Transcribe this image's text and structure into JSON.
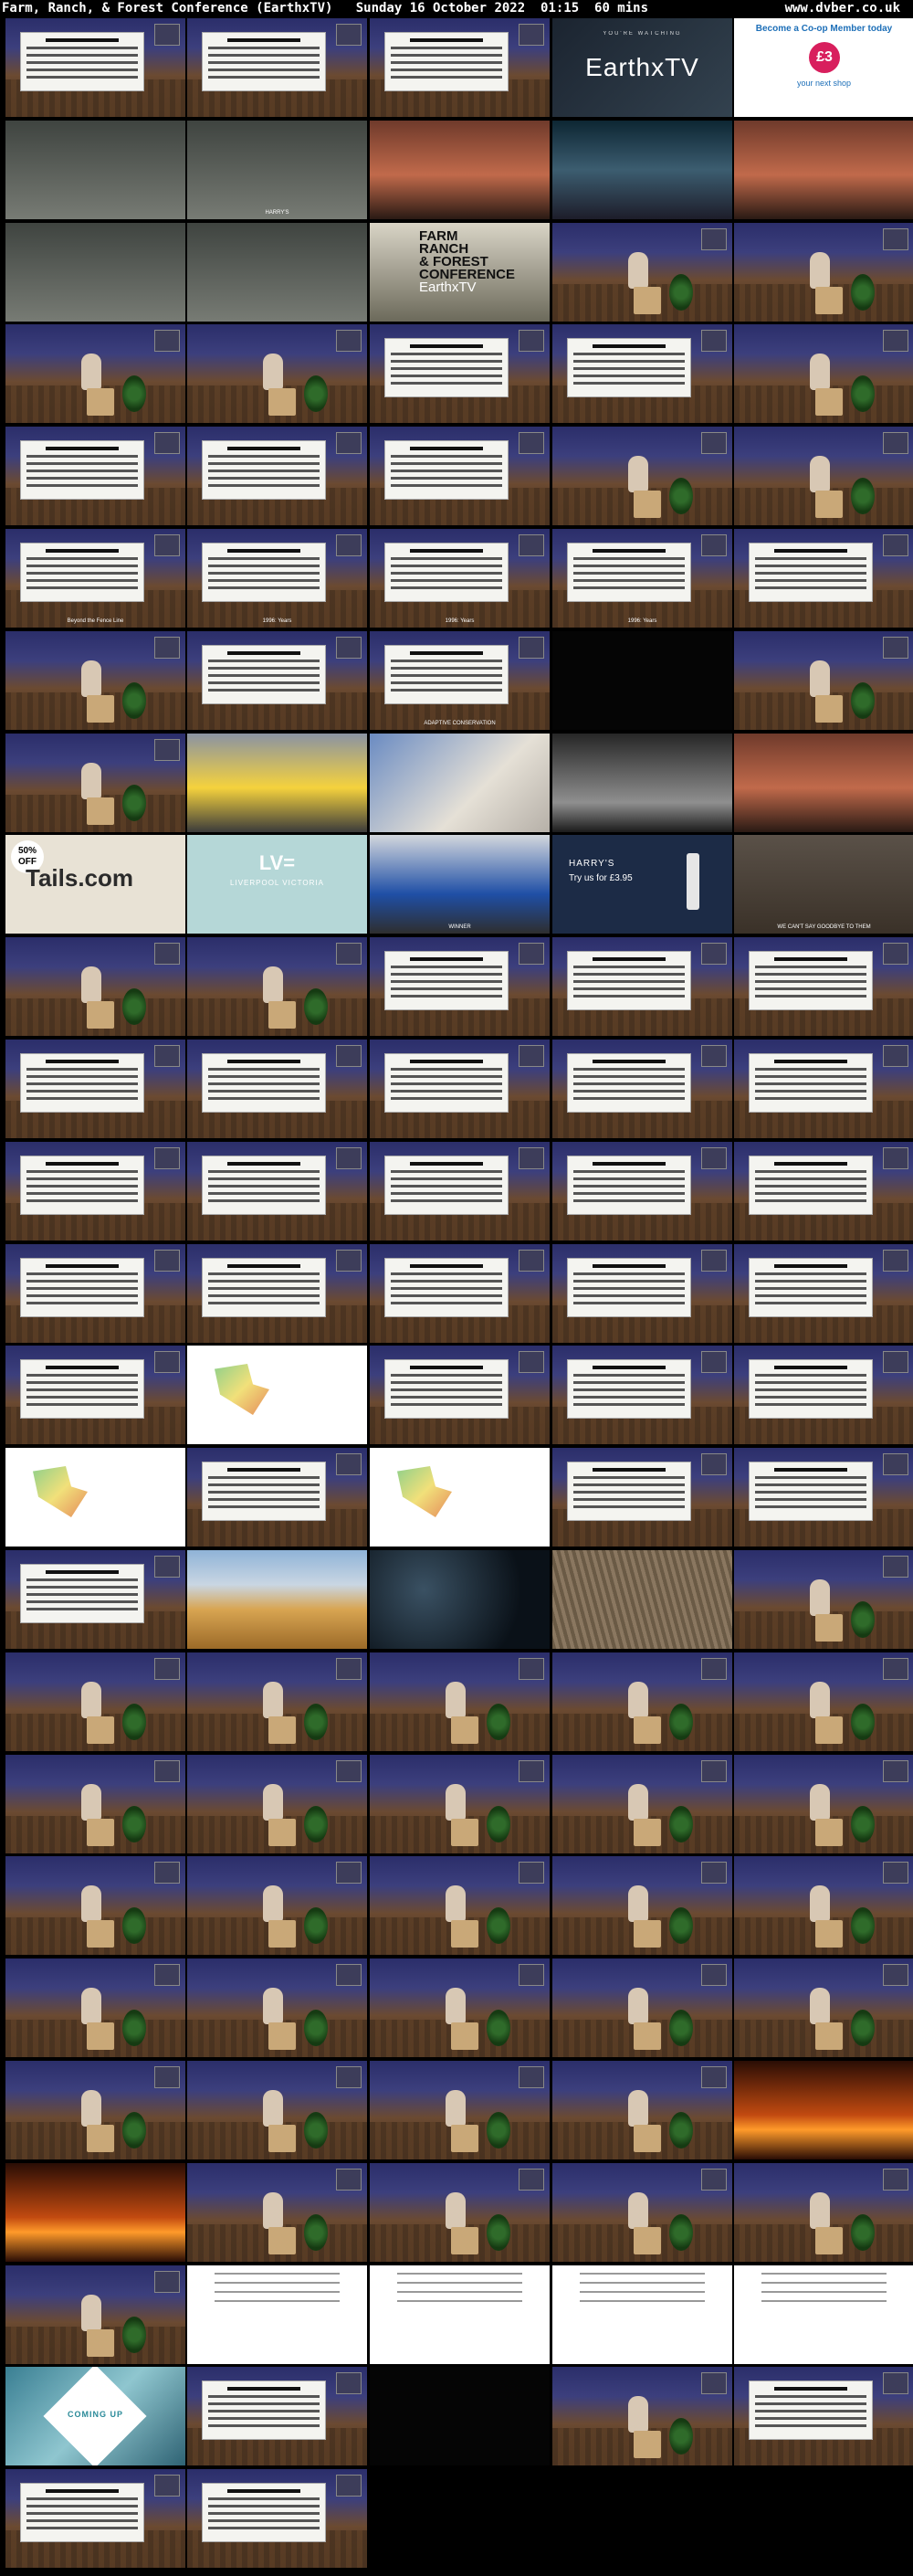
{
  "header": {
    "title": "Farm, Ranch, & Forest Conference (EarthxTV)   Sunday 16 October 2022  01:15  60 mins",
    "site": "www.dvber.co.uk"
  },
  "thumbnails": [
    {
      "kind": "slide"
    },
    {
      "kind": "slide"
    },
    {
      "kind": "slide"
    },
    {
      "kind": "earthx",
      "small": "YOU'RE WATCHING",
      "big": "EarthxTV"
    },
    {
      "kind": "coop",
      "title": "Become a Co-op Member today",
      "badge": "£3",
      "sub": "your next shop"
    },
    {
      "kind": "phone"
    },
    {
      "kind": "phone",
      "caption": "HARRY'S"
    },
    {
      "kind": "desert"
    },
    {
      "kind": "sky"
    },
    {
      "kind": "desert"
    },
    {
      "kind": "phone"
    },
    {
      "kind": "phone"
    },
    {
      "kind": "farm",
      "lines": [
        "FARM",
        "RANCH",
        "& FOREST",
        "CONFERENCE"
      ],
      "brand": "EarthxTV"
    },
    {
      "kind": "stage"
    },
    {
      "kind": "stage"
    },
    {
      "kind": "stage"
    },
    {
      "kind": "stage"
    },
    {
      "kind": "slide"
    },
    {
      "kind": "slide"
    },
    {
      "kind": "stage"
    },
    {
      "kind": "slide"
    },
    {
      "kind": "slide"
    },
    {
      "kind": "slide"
    },
    {
      "kind": "stage"
    },
    {
      "kind": "stage"
    },
    {
      "kind": "slide",
      "text": "Beyond the Fence Line"
    },
    {
      "kind": "slide",
      "text": "1996: Years"
    },
    {
      "kind": "slide",
      "text": "1996: Years"
    },
    {
      "kind": "slide",
      "text": "1996: Years"
    },
    {
      "kind": "slide"
    },
    {
      "kind": "stage"
    },
    {
      "kind": "slide"
    },
    {
      "kind": "slide",
      "text": "ADAPTIVE CONSERVATION"
    },
    {
      "kind": "dark"
    },
    {
      "kind": "stage"
    },
    {
      "kind": "stage"
    },
    {
      "kind": "car"
    },
    {
      "kind": "bread"
    },
    {
      "kind": "chess"
    },
    {
      "kind": "desert"
    },
    {
      "kind": "tails",
      "off": "50% OFF",
      "big": "Tails.com"
    },
    {
      "kind": "lv",
      "logo": "LV=",
      "txt": "LIVERPOOL VICTORIA"
    },
    {
      "kind": "blue-car",
      "caption": "WINNER"
    },
    {
      "kind": "harrys",
      "brand": "HARRY'S",
      "offer": "Try us for £3.95"
    },
    {
      "kind": "elephant",
      "caption": "WE CAN'T SAY GOODBYE TO THEM"
    },
    {
      "kind": "stage"
    },
    {
      "kind": "stage"
    },
    {
      "kind": "slide"
    },
    {
      "kind": "slide"
    },
    {
      "kind": "slide"
    },
    {
      "kind": "slide"
    },
    {
      "kind": "slide"
    },
    {
      "kind": "slide"
    },
    {
      "kind": "slide"
    },
    {
      "kind": "slide"
    },
    {
      "kind": "slide"
    },
    {
      "kind": "slide"
    },
    {
      "kind": "slide"
    },
    {
      "kind": "slide"
    },
    {
      "kind": "slide"
    },
    {
      "kind": "slide"
    },
    {
      "kind": "slide"
    },
    {
      "kind": "slide"
    },
    {
      "kind": "slide"
    },
    {
      "kind": "slide"
    },
    {
      "kind": "slide"
    },
    {
      "kind": "map"
    },
    {
      "kind": "slide"
    },
    {
      "kind": "slide"
    },
    {
      "kind": "slide"
    },
    {
      "kind": "map"
    },
    {
      "kind": "slide"
    },
    {
      "kind": "map"
    },
    {
      "kind": "slide"
    },
    {
      "kind": "slide"
    },
    {
      "kind": "slide"
    },
    {
      "kind": "wheat"
    },
    {
      "kind": "night"
    },
    {
      "kind": "combine"
    },
    {
      "kind": "stage"
    },
    {
      "kind": "stage"
    },
    {
      "kind": "stage"
    },
    {
      "kind": "stage"
    },
    {
      "kind": "stage"
    },
    {
      "kind": "stage"
    },
    {
      "kind": "stage"
    },
    {
      "kind": "stage"
    },
    {
      "kind": "stage"
    },
    {
      "kind": "stage"
    },
    {
      "kind": "stage"
    },
    {
      "kind": "stage"
    },
    {
      "kind": "stage"
    },
    {
      "kind": "stage"
    },
    {
      "kind": "stage"
    },
    {
      "kind": "stage"
    },
    {
      "kind": "stage"
    },
    {
      "kind": "stage"
    },
    {
      "kind": "stage"
    },
    {
      "kind": "stage"
    },
    {
      "kind": "stage"
    },
    {
      "kind": "stage"
    },
    {
      "kind": "stage"
    },
    {
      "kind": "stage"
    },
    {
      "kind": "stage"
    },
    {
      "kind": "fire"
    },
    {
      "kind": "fire"
    },
    {
      "kind": "stage"
    },
    {
      "kind": "stage"
    },
    {
      "kind": "stage"
    },
    {
      "kind": "stage"
    },
    {
      "kind": "stage"
    },
    {
      "kind": "white"
    },
    {
      "kind": "white"
    },
    {
      "kind": "white"
    },
    {
      "kind": "white"
    },
    {
      "kind": "coming",
      "label": "COMING UP"
    },
    {
      "kind": "slide"
    },
    {
      "kind": "dark"
    },
    {
      "kind": "stage"
    },
    {
      "kind": "slide"
    },
    {
      "kind": "slide"
    },
    {
      "kind": "slide"
    }
  ]
}
